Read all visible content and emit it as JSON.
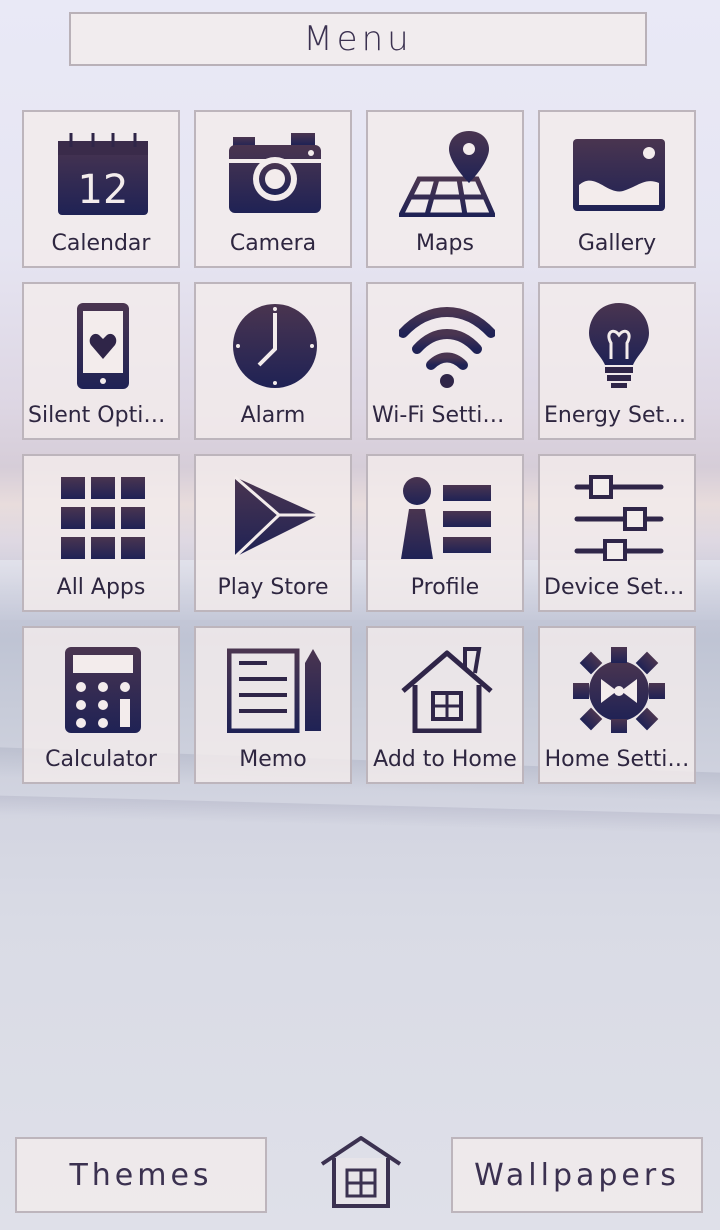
{
  "header": {
    "title": "Menu"
  },
  "tiles": [
    {
      "label": "Calendar",
      "icon": "calendar-icon",
      "date": "12"
    },
    {
      "label": "Camera",
      "icon": "camera-icon"
    },
    {
      "label": "Maps",
      "icon": "map-icon"
    },
    {
      "label": "Gallery",
      "icon": "gallery-icon"
    },
    {
      "label": "Silent Options",
      "icon": "phone-heart-icon"
    },
    {
      "label": "Alarm",
      "icon": "clock-icon"
    },
    {
      "label": "Wi-Fi Settings",
      "icon": "wifi-icon"
    },
    {
      "label": "Energy Setti…",
      "icon": "lightbulb-icon"
    },
    {
      "label": "All Apps",
      "icon": "grid-icon"
    },
    {
      "label": "Play Store",
      "icon": "play-store-icon"
    },
    {
      "label": "Profile",
      "icon": "profile-icon"
    },
    {
      "label": "Device Setti…",
      "icon": "sliders-icon"
    },
    {
      "label": "Calculator",
      "icon": "calculator-icon"
    },
    {
      "label": "Memo",
      "icon": "memo-icon"
    },
    {
      "label": "Add to Home",
      "icon": "house-icon"
    },
    {
      "label": "Home Setti…",
      "icon": "gear-icon"
    }
  ],
  "footer": {
    "themes_label": "Themes",
    "wallpapers_label": "Wallpapers"
  },
  "colors": {
    "icon": "#2f2548",
    "tile_bg": "#f3ecec",
    "tile_border": "#bdb5bc"
  }
}
